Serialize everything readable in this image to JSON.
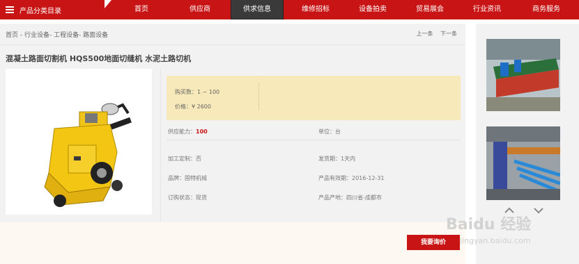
{
  "nav": {
    "category_label": "产品分类目录",
    "items": [
      "首页",
      "供应商",
      "供求信息",
      "维修招标",
      "设备拍卖",
      "贸易展会",
      "行业资讯",
      "商务服务"
    ],
    "active_index": 2
  },
  "breadcrumb": "首页 - 行业设备- 工程设备- 路面设备",
  "pager": {
    "prev": "上一条",
    "next": "下一条"
  },
  "product": {
    "title": "混凝土路面切割机 HQS500地面切缝机 水泥土路切机",
    "buy_qty": "购买数：1 ~ 100",
    "price": "价格：¥ 2600",
    "supply_label": "供应能力：",
    "supply_value": "100",
    "unit": "单位：台",
    "custom": "加工定制：否",
    "delivery": "发货期：1天内",
    "brand": "品牌：固特机械",
    "validity": "产品有效期：2016-12-31",
    "order_status": "订购状态：现货",
    "origin": "产品产地：四川省-成都市"
  },
  "inquiry_button": "我要询价",
  "watermark": {
    "main": "Baidu 经验",
    "sub": "jingyan.baidu.com"
  },
  "colors": {
    "brand_red": "#c81414",
    "price_bg": "#f7e9b9"
  }
}
